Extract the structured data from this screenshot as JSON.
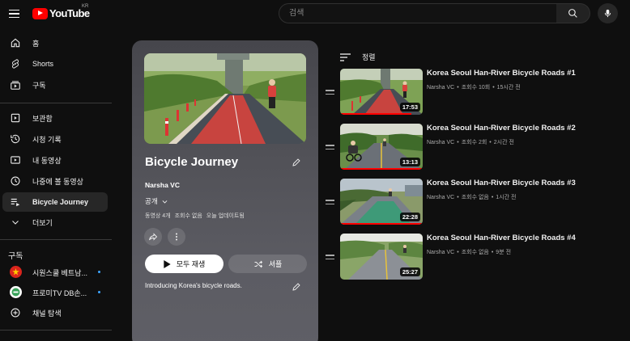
{
  "topbar": {
    "logo_text": "YouTube",
    "region": "KR",
    "search_placeholder": "검색"
  },
  "sidebar": {
    "main": [
      {
        "label": "홈",
        "icon": "home-icon"
      },
      {
        "label": "Shorts",
        "icon": "shorts-icon"
      },
      {
        "label": "구독",
        "icon": "subscriptions-icon"
      }
    ],
    "library": [
      {
        "label": "보관함",
        "icon": "library-icon"
      },
      {
        "label": "시청 기록",
        "icon": "history-icon"
      },
      {
        "label": "내 동영상",
        "icon": "my-videos-icon"
      },
      {
        "label": "나중에 볼 동영상",
        "icon": "watch-later-icon"
      },
      {
        "label": "Bicycle Journey",
        "icon": "playlist-icon",
        "active": true
      },
      {
        "label": "더보기",
        "icon": "chevron-down-icon"
      }
    ],
    "subs_title": "구독",
    "subscriptions": [
      {
        "label": "시원스쿨 베트남...",
        "live": true
      },
      {
        "label": "프로미TV DB손...",
        "live": true
      }
    ],
    "browse_channels": "채널 탐색"
  },
  "playlist": {
    "title": "Bicycle Journey",
    "owner": "Narsha VC",
    "privacy": "공개",
    "stats": [
      "동영상 4개",
      "조회수 없음",
      "오늘 업데이트됨"
    ],
    "play_all": "모두 재생",
    "shuffle": "셔플",
    "description": "Introducing Korea's bicycle roads."
  },
  "sort_label": "정렬",
  "videos": [
    {
      "title": "Korea Seoul Han-River Bicycle Roads #1",
      "channel": "Narsha VC",
      "views": "조회수 10회",
      "time": "15시간 전",
      "duration": "17:53",
      "progress": 0.86
    },
    {
      "title": "Korea Seoul Han-River Bicycle Roads #2",
      "channel": "Narsha VC",
      "views": "조회수 2회",
      "time": "2시간 전",
      "duration": "13:13",
      "progress": 1.0
    },
    {
      "title": "Korea Seoul Han-River Bicycle Roads #3",
      "channel": "Narsha VC",
      "views": "조회수 없음",
      "time": "1시간 전",
      "duration": "22:28",
      "progress": 1.0
    },
    {
      "title": "Korea Seoul Han-River Bicycle Roads #4",
      "channel": "Narsha VC",
      "views": "조회수 없음",
      "time": "9분 전",
      "duration": "25:27",
      "progress": 0
    }
  ],
  "meta_separator": "•",
  "colors": {
    "accent": "#ff0000",
    "live": "#3ea6ff",
    "background": "#0f0f0f"
  }
}
